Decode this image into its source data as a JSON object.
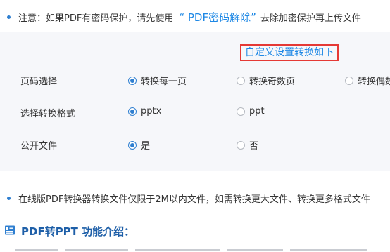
{
  "notice": {
    "prefix": "注意：如果PDF有密码保护，请先使用",
    "link": "“ PDF密码解除”",
    "suffix": "去除加密保护再上传文件"
  },
  "settings": {
    "custom_link": "自定义设置转换如下",
    "page_select": {
      "label": "页码选择",
      "options": [
        "转换每一页",
        "转换奇数页",
        "转换偶数页"
      ],
      "selected": 0
    },
    "format_select": {
      "label": "选择转换格式",
      "options": [
        "pptx",
        "ppt"
      ],
      "selected": 0
    },
    "public_file": {
      "label": "公开文件",
      "options": [
        "是",
        "否"
      ],
      "selected": 0
    }
  },
  "limit_notice": "在线版PDF转换器转换文件仅限于2M以内文件，如需转换更大文件、转换更多格式文件",
  "intro": {
    "title": "PDF转PPT 功能介绍：",
    "icon": "document-list-icon"
  },
  "colors": {
    "accent": "#1e88e5",
    "highlight_border": "#e53935",
    "panel_bg": "#f6f7fa",
    "title": "#1e5fa8"
  }
}
